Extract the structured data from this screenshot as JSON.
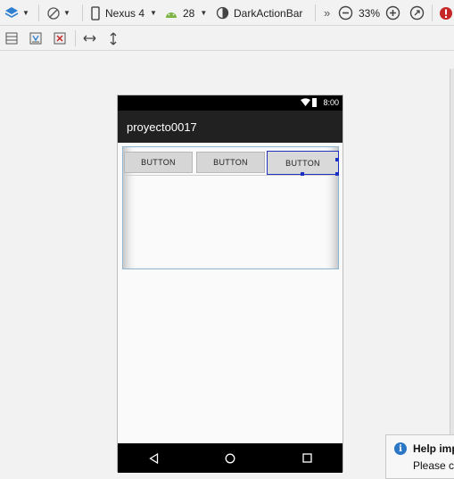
{
  "toolbar": {
    "device": "Nexus 4",
    "api_level": "28",
    "theme": "DarkActionBar",
    "zoom": "33%",
    "more": "»"
  },
  "device_screen": {
    "status_time": "8:00",
    "app_title": "proyecto0017",
    "buttons": [
      {
        "label": "BUTTON"
      },
      {
        "label": "BUTTON"
      },
      {
        "label": "BUTTON"
      }
    ]
  },
  "help_popup": {
    "title": "Help imp",
    "body": "Please cl"
  },
  "colors": {
    "accent": "#2233bb",
    "error_badge": "#c62828",
    "android_green": "#7cb342",
    "info_blue": "#2b77c6"
  }
}
